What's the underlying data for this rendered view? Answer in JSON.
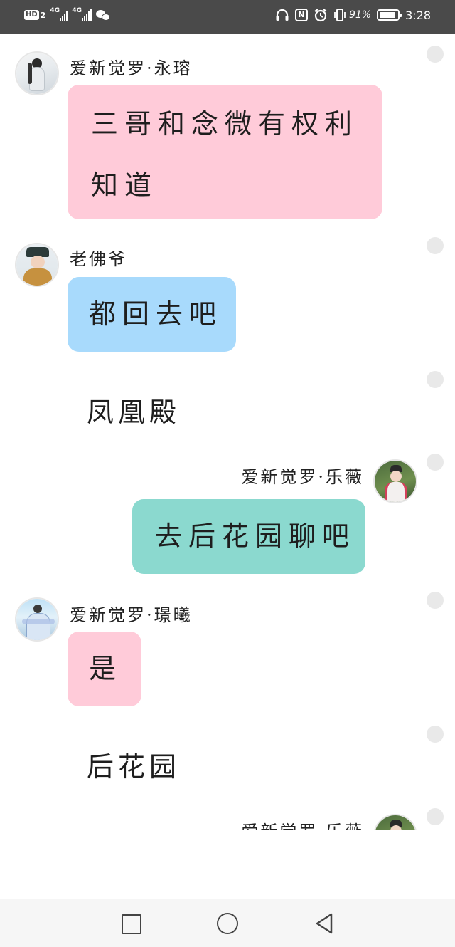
{
  "status_bar": {
    "hd_label": "HD",
    "sim_number": "2",
    "signal1_label": "4G",
    "signal2_label": "4G",
    "nfc_label": "N",
    "battery_percent_text": "91%",
    "battery_level": 0.91,
    "time": "3:28"
  },
  "messages": [
    {
      "sender": "爱新觉罗·永瑢",
      "text": "三哥和念微有权利知道",
      "line1": "三哥和念微有权利",
      "line2": "知道"
    },
    {
      "sender": "老佛爷",
      "text": "都回去吧"
    },
    {
      "text": "凤凰殿"
    },
    {
      "sender": "爱新觉罗·乐薇",
      "text": "去后花园聊吧"
    },
    {
      "sender": "爱新觉罗·璟曦",
      "text": "是"
    },
    {
      "text": "后花园"
    },
    {
      "sender": "爱新觉罗·乐薇"
    }
  ],
  "colors": {
    "status_bar_bg": "#4a4a4a",
    "bubble_pink": "#ffcbd9",
    "bubble_blue": "#a8dafc",
    "bubble_teal": "#8bd9cf",
    "nav_bar_bg": "#f6f6f6"
  },
  "icons": {
    "status_bar": [
      "hd-icon",
      "signal-icon",
      "wechat-icon",
      "headphones-icon",
      "nfc-icon",
      "alarm-icon",
      "vibrate-icon",
      "battery-icon"
    ],
    "nav_bar": [
      "recent-apps-icon",
      "home-icon",
      "back-icon"
    ]
  }
}
